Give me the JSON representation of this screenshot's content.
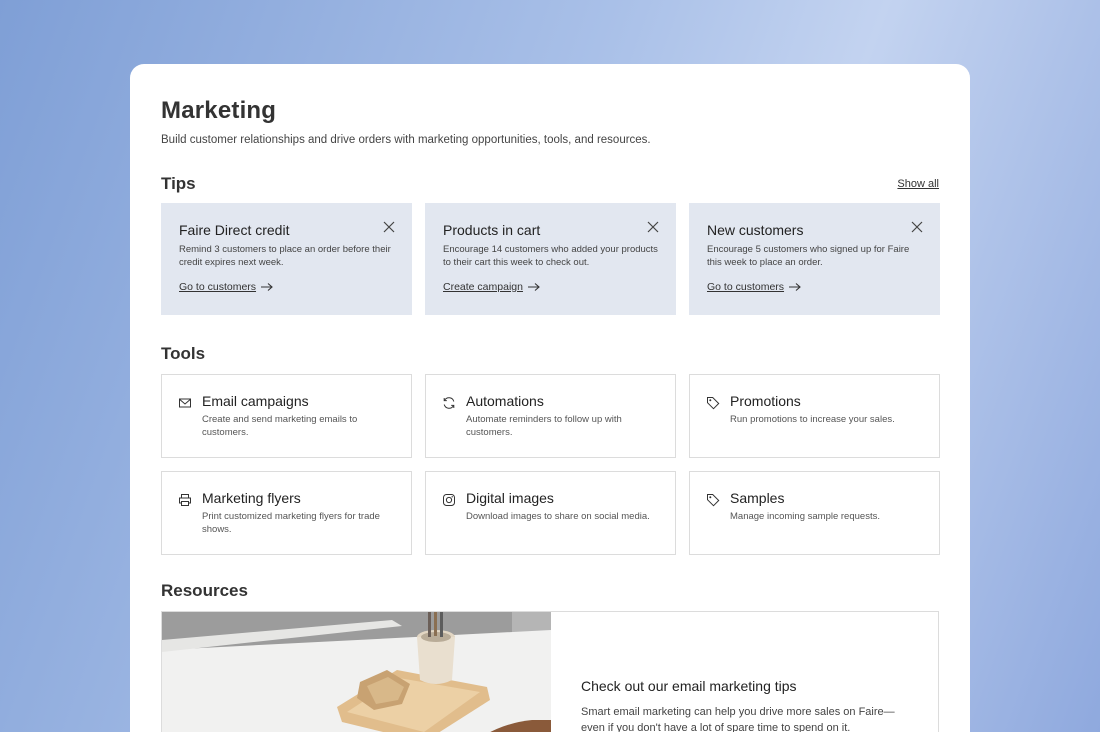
{
  "page": {
    "title": "Marketing",
    "subtitle": "Build customer relationships and drive orders with marketing opportunities, tools, and resources."
  },
  "tips": {
    "heading": "Tips",
    "show_all": "Show all",
    "items": [
      {
        "title": "Faire Direct credit",
        "text": "Remind 3 customers to place an order before their credit expires next week.",
        "link": "Go to customers"
      },
      {
        "title": "Products in cart",
        "text": "Encourage 14 customers who added your products to their cart this week to check out.",
        "link": "Create campaign"
      },
      {
        "title": "New customers",
        "text": "Encourage 5 customers who signed up for Faire this week to place an order.",
        "link": "Go to customers"
      }
    ]
  },
  "tools": {
    "heading": "Tools",
    "items": [
      {
        "title": "Email campaigns",
        "text": "Create and send marketing emails to customers.",
        "icon": "mail-icon"
      },
      {
        "title": "Automations",
        "text": "Automate reminders to follow up with customers.",
        "icon": "refresh-icon"
      },
      {
        "title": "Promotions",
        "text": "Run promotions to increase your sales.",
        "icon": "tag-icon"
      },
      {
        "title": "Marketing flyers",
        "text": "Print customized marketing flyers for trade shows.",
        "icon": "printer-icon"
      },
      {
        "title": "Digital images",
        "text": "Download images to share on social media.",
        "icon": "instagram-icon"
      },
      {
        "title": "Samples",
        "text": "Manage incoming sample requests.",
        "icon": "tag-icon"
      }
    ]
  },
  "resources": {
    "heading": "Resources",
    "title": "Check out our email marketing tips",
    "text": "Smart email marketing can help you drive more sales on Faire—even if you don't have a lot of spare time to spend on it."
  }
}
